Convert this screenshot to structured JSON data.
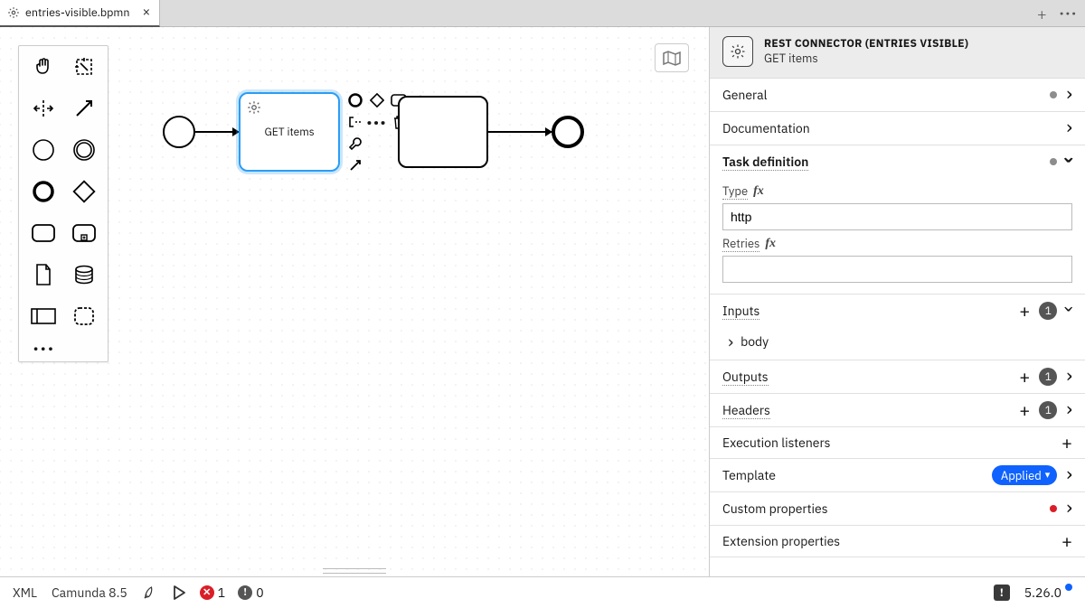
{
  "tab": {
    "title": "entries-visible.bpmn",
    "close_glyph": "×"
  },
  "tabbar_actions": {
    "plus_glyph": "+",
    "more_glyph": "•••"
  },
  "diagram": {
    "selected_task_label": "GET items",
    "second_task_visible": true,
    "second_task_label": ""
  },
  "panel": {
    "header": {
      "title": "REST CONNECTOR (ENTRIES VISIBLE)",
      "subtitle": "GET items"
    },
    "sections": {
      "general": {
        "title": "General"
      },
      "documentation": {
        "title": "Documentation"
      },
      "task_definition": {
        "title": "Task definition",
        "type_label": "Type",
        "type_value": "http",
        "retries_label": "Retries",
        "retries_value": ""
      },
      "inputs": {
        "title": "Inputs",
        "count": "1",
        "items": [
          {
            "label": "body"
          }
        ]
      },
      "outputs": {
        "title": "Outputs",
        "count": "1"
      },
      "headers": {
        "title": "Headers",
        "count": "1"
      },
      "execution_listeners": {
        "title": "Execution listeners"
      },
      "template": {
        "title": "Template",
        "applied_label": "Applied"
      },
      "custom_properties": {
        "title": "Custom properties"
      },
      "extension_properties": {
        "title": "Extension properties"
      }
    }
  },
  "statusbar": {
    "xml": "XML",
    "platform": "Camunda 8.5",
    "errors": "1",
    "warnings": "0",
    "version": "5.26.0"
  }
}
